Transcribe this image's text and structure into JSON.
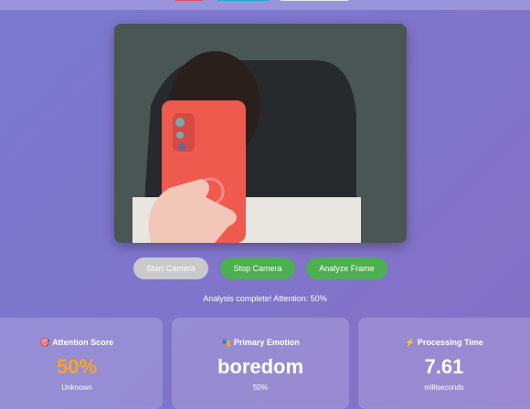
{
  "controls": {
    "start": "Start Camera",
    "stop": "Stop Camera",
    "analyze": "Analyze Frame"
  },
  "status": "Analysis complete! Attention: 50%",
  "cards": [
    {
      "icon": "🎯",
      "title": "Attention Score",
      "value": "50%",
      "sub": "Unknown",
      "color": "#f5a623"
    },
    {
      "icon": "🎭",
      "title": "Primary Emotion",
      "value": "boredom",
      "sub": "50%"
    },
    {
      "icon": "⚡",
      "title": "Processing Time",
      "value": "7.61",
      "sub": "milliseconds"
    }
  ]
}
